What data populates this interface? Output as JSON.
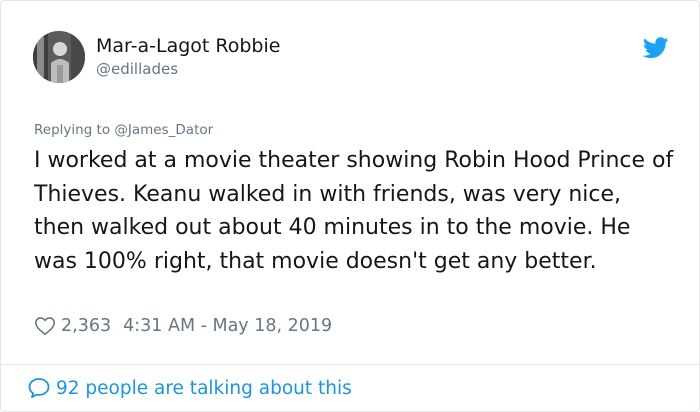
{
  "user": {
    "display_name": "Mar-a-Lagot Robbie",
    "handle": "@edillades",
    "avatar_icon": "user-avatar"
  },
  "brand": {
    "icon": "twitter-bird-icon",
    "color": "#1da1f2"
  },
  "reply": {
    "prefix": "Replying to",
    "mention": "@James_Dator"
  },
  "tweet": {
    "text": "I worked at a movie theater showing Robin Hood Prince of Thieves. Keanu walked in with friends, was very nice, then walked out about 40 minutes in to the movie. He was 100% right, that movie doesn't get any better."
  },
  "meta": {
    "like_icon": "heart-icon",
    "likes": "2,363",
    "timestamp": "4:31 AM - May 18, 2019"
  },
  "conversation": {
    "icon": "speech-bubble-icon",
    "label": "92 people are talking about this",
    "color": "#1b95e0"
  }
}
